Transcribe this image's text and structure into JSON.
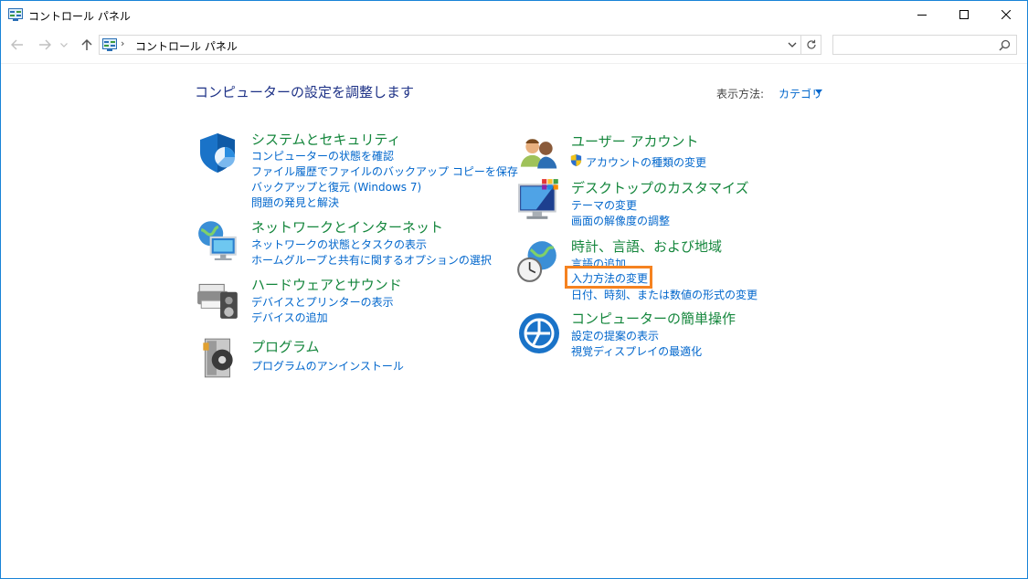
{
  "window": {
    "title": "コントロール パネル",
    "icon": "control-panel-icon",
    "controls": [
      "minimize-icon",
      "maximize-icon",
      "close-icon"
    ]
  },
  "address": {
    "crumb": "コントロール パネル",
    "separator": "›"
  },
  "search": {
    "placeholder": ""
  },
  "main": {
    "heading": "コンピューターの設定を調整します",
    "view_by_label": "表示方法:",
    "view_by_value": "カテゴリ"
  },
  "categories": [
    {
      "title": "システムとセキュリティ",
      "icon": "shield-icon",
      "links": [
        "コンピューターの状態を確認",
        "ファイル履歴でファイルのバックアップ コピーを保存",
        "バックアップと復元 (Windows 7)",
        "問題の発見と解決"
      ]
    },
    {
      "title": "ネットワークとインターネット",
      "icon": "network-globe-icon",
      "links": [
        "ネットワークの状態とタスクの表示",
        "ホームグループと共有に関するオプションの選択"
      ]
    },
    {
      "title": "ハードウェアとサウンド",
      "icon": "printer-speaker-icon",
      "links": [
        "デバイスとプリンターの表示",
        "デバイスの追加"
      ]
    },
    {
      "title": "プログラム",
      "icon": "program-disc-icon",
      "links": [
        "プログラムのアンインストール"
      ]
    },
    {
      "title": "ユーザー アカウント",
      "icon": "users-icon",
      "links": [
        "アカウントの種類の変更"
      ]
    },
    {
      "title": "デスクトップのカスタマイズ",
      "icon": "monitor-icon",
      "links": [
        "テーマの変更",
        "画面の解像度の調整"
      ]
    },
    {
      "title": "時計、言語、および地域",
      "icon": "clock-globe-icon",
      "links": [
        "言語の追加",
        "入力方法の変更",
        "日付、時刻、または数値の形式の変更"
      ]
    },
    {
      "title": "コンピューターの簡単操作",
      "icon": "ease-of-access-icon",
      "links": [
        "設定の提案の表示",
        "視覚ディスプレイの最適化"
      ]
    }
  ],
  "colors": {
    "category_title": "#14863c",
    "link": "#0066cc",
    "heading": "#1e3287",
    "highlight": "#f58220",
    "window_border": "#1883d7"
  }
}
